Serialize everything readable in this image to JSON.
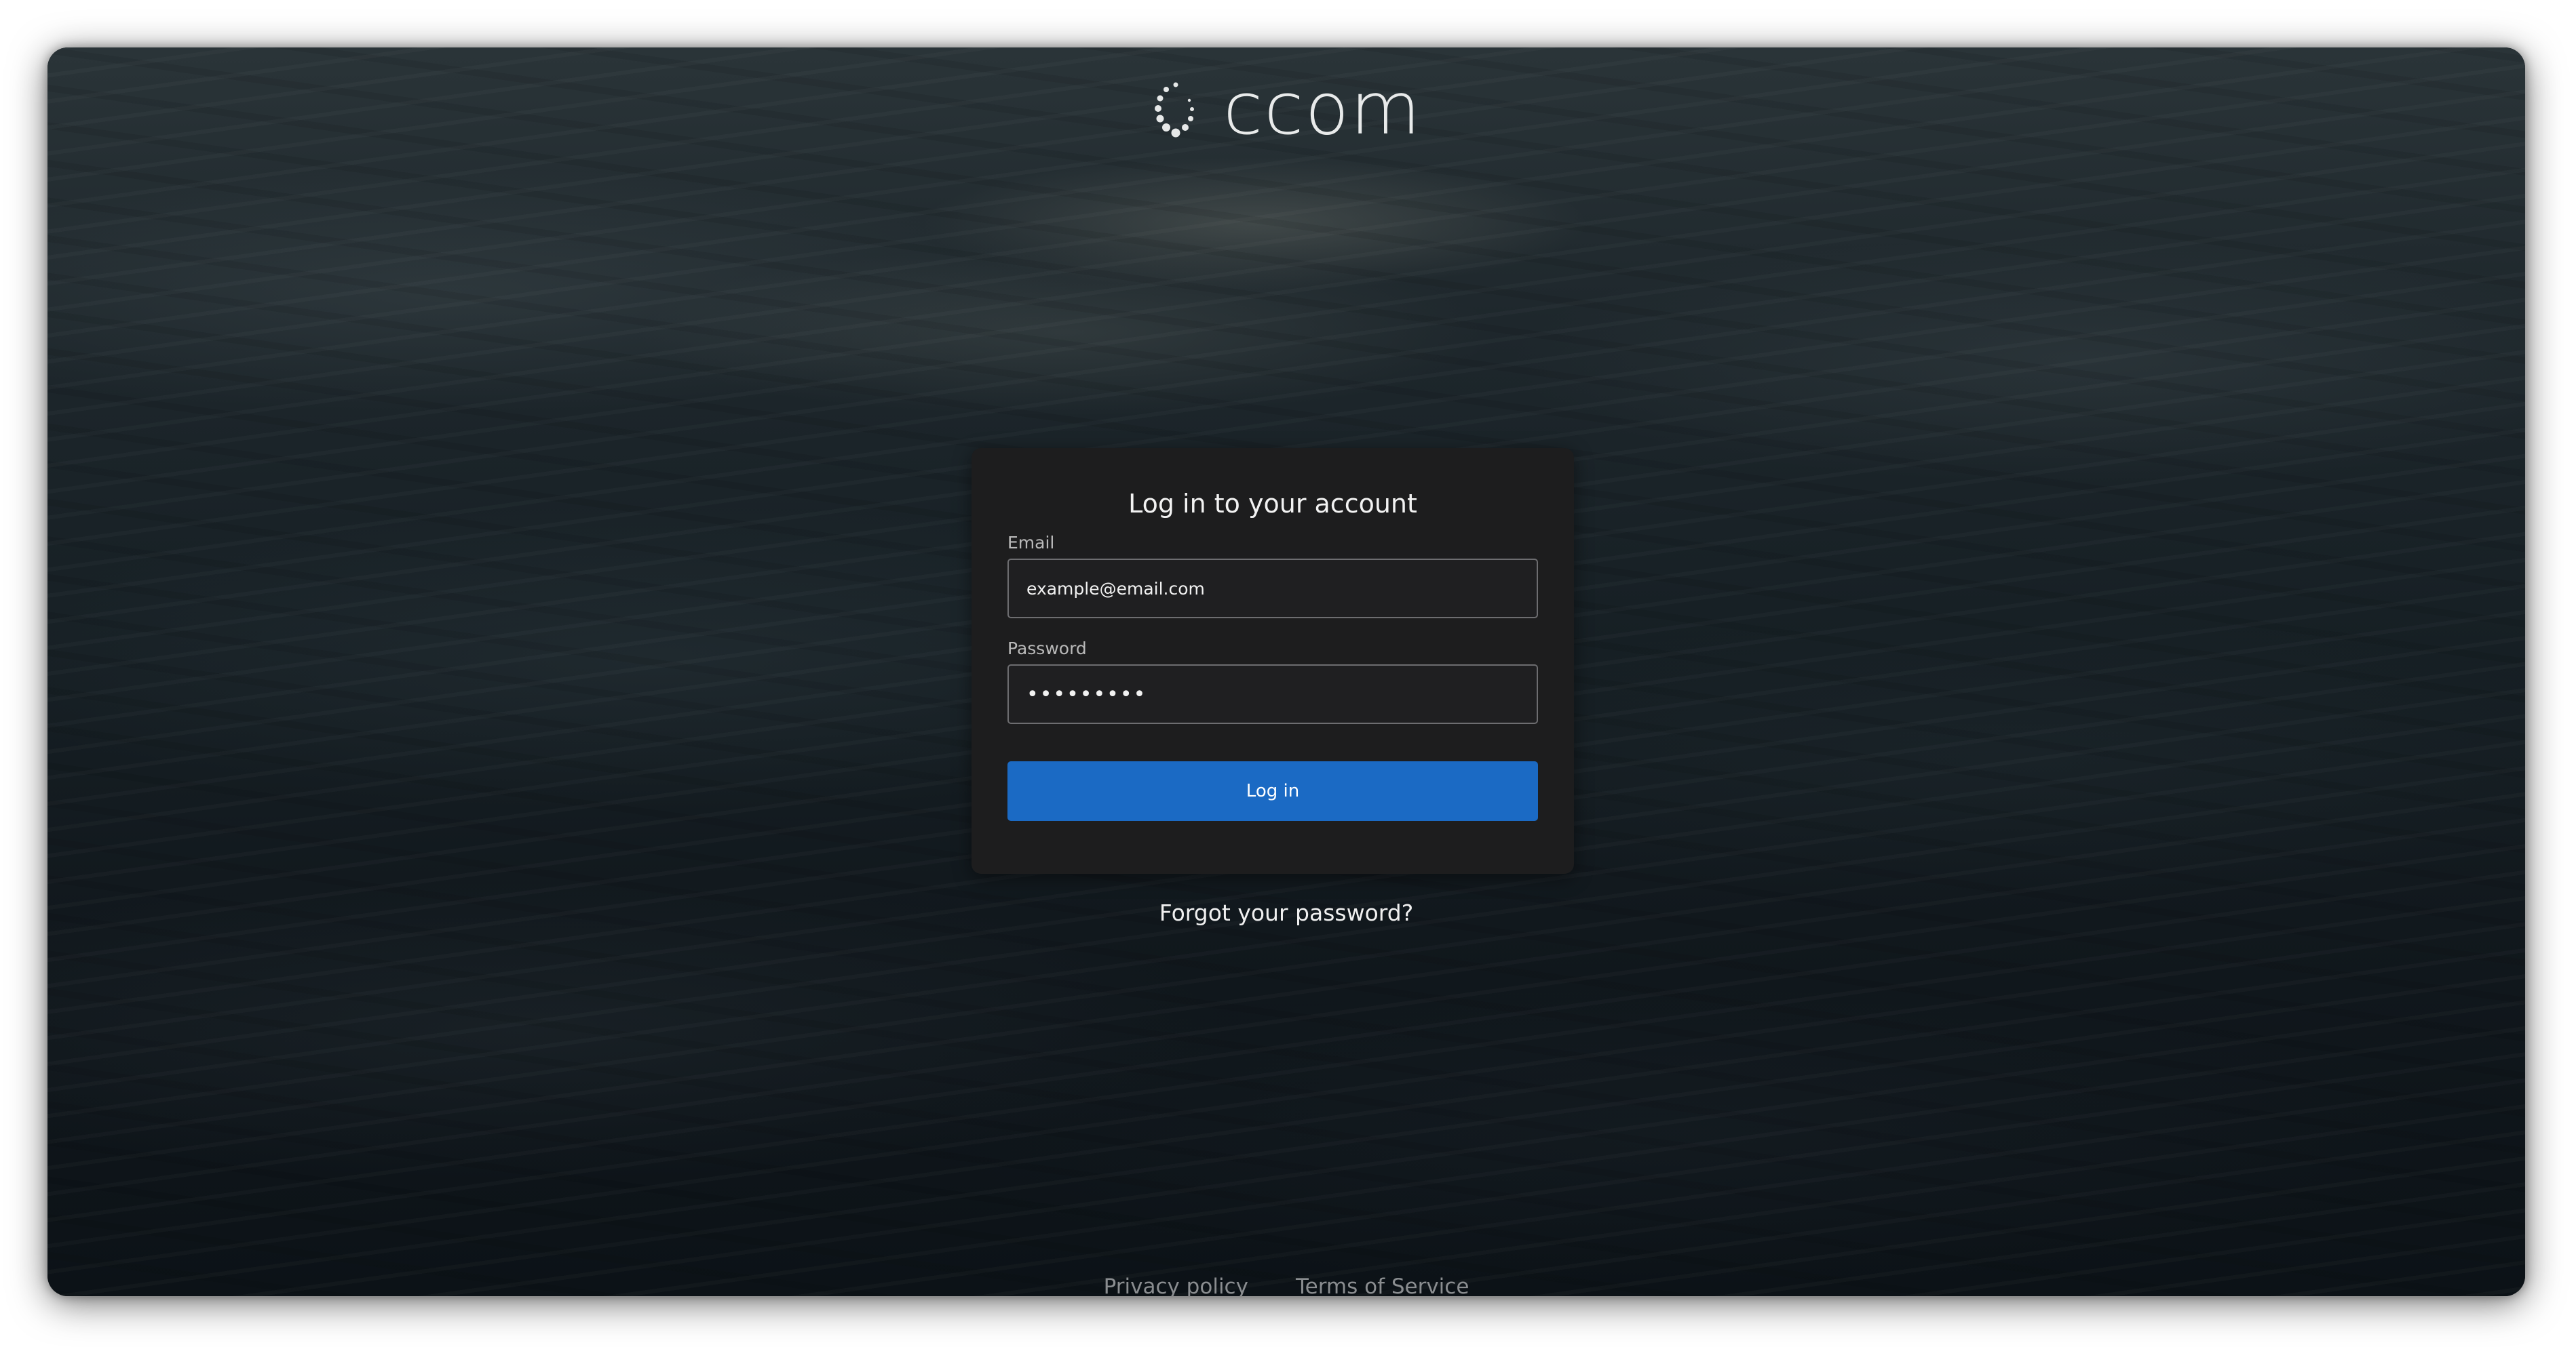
{
  "brand": {
    "logo_text": "ccom",
    "logo_icon": "spinner-dots-icon"
  },
  "login": {
    "title": "Log in to your account",
    "email_label": "Email",
    "email_value": "example@email.com",
    "password_label": "Password",
    "password_value": "•••••••••",
    "submit_label": "Log in",
    "forgot_label": "Forgot your password?"
  },
  "footer": {
    "privacy_label": "Privacy policy",
    "terms_label": "Terms of Service"
  },
  "colors": {
    "primary_button": "#1b6ac4",
    "card_background": "#1d1d1e",
    "input_border": "#6d6d70"
  }
}
